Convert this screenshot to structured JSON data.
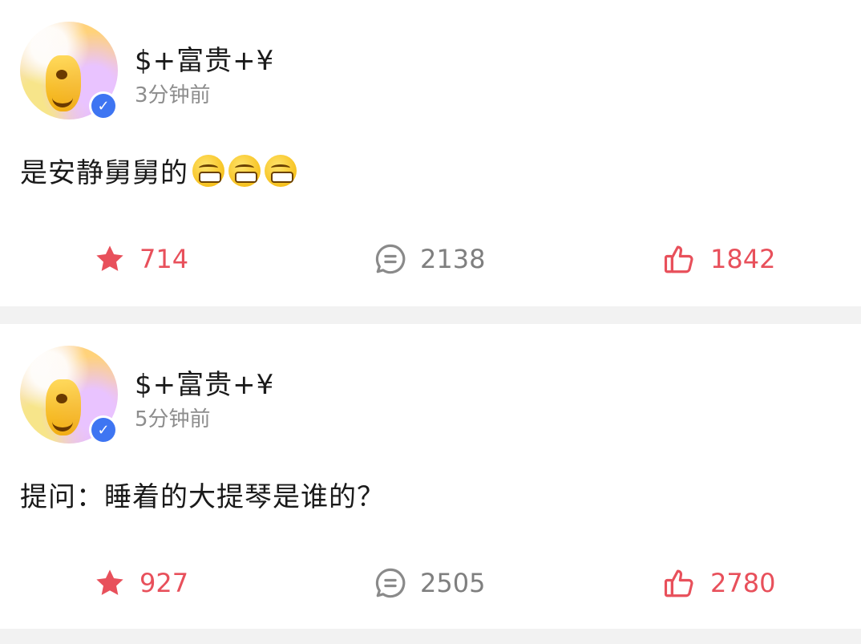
{
  "posts": [
    {
      "username": "$+富贵+¥",
      "time": "3分钟前",
      "text": "是安静舅舅的",
      "emoji_count": 3,
      "favorites": "714",
      "comments": "2138",
      "likes": "1842"
    },
    {
      "username": "$+富贵+¥",
      "time": "5分钟前",
      "text": "提问：睡着的大提琴是谁的？",
      "emoji_count": 0,
      "favorites": "927",
      "comments": "2505",
      "likes": "2780"
    }
  ],
  "icons": {
    "avatar": "avatar-image",
    "verified": "verified-v-badge-icon",
    "emoji": "grinning-emoji-icon",
    "favorite": "star-icon",
    "comment": "comment-bubble-icon",
    "like": "thumbs-up-icon"
  },
  "colors": {
    "accent": "#e8505b",
    "muted": "#8d8d8d",
    "verified": "#3e75f2",
    "background": "#f2f2f2"
  }
}
